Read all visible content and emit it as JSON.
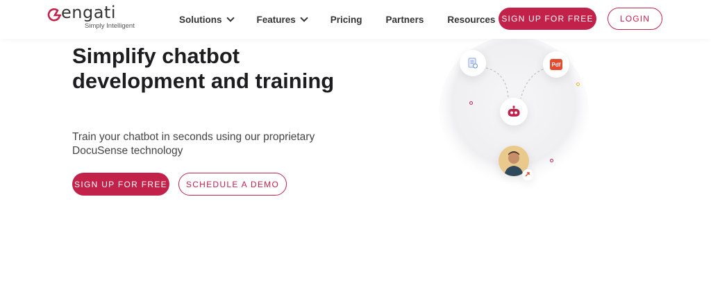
{
  "brand": {
    "name": "engati",
    "tagline": "Simply Intelligent",
    "color": "#c2214a"
  },
  "nav": {
    "items": [
      {
        "label": "Solutions",
        "has_dropdown": true
      },
      {
        "label": "Features",
        "has_dropdown": true
      },
      {
        "label": "Pricing",
        "has_dropdown": false
      },
      {
        "label": "Partners",
        "has_dropdown": false
      },
      {
        "label": "Resources",
        "has_dropdown": true
      }
    ],
    "signup_label": "SIGN UP FOR FREE",
    "login_label": "LOGIN"
  },
  "hero": {
    "title": "Simplify chatbot development and training",
    "subtitle": "Train your chatbot in seconds using our proprietary DocuSense technology",
    "primary_cta": "SIGN UP FOR FREE",
    "secondary_cta": "SCHEDULE A DEMO"
  },
  "illustration": {
    "pdf_label": "Pdf",
    "icons": [
      "document-icon",
      "pdf-icon",
      "chatbot-icon",
      "user-avatar",
      "arrow-icon"
    ]
  }
}
